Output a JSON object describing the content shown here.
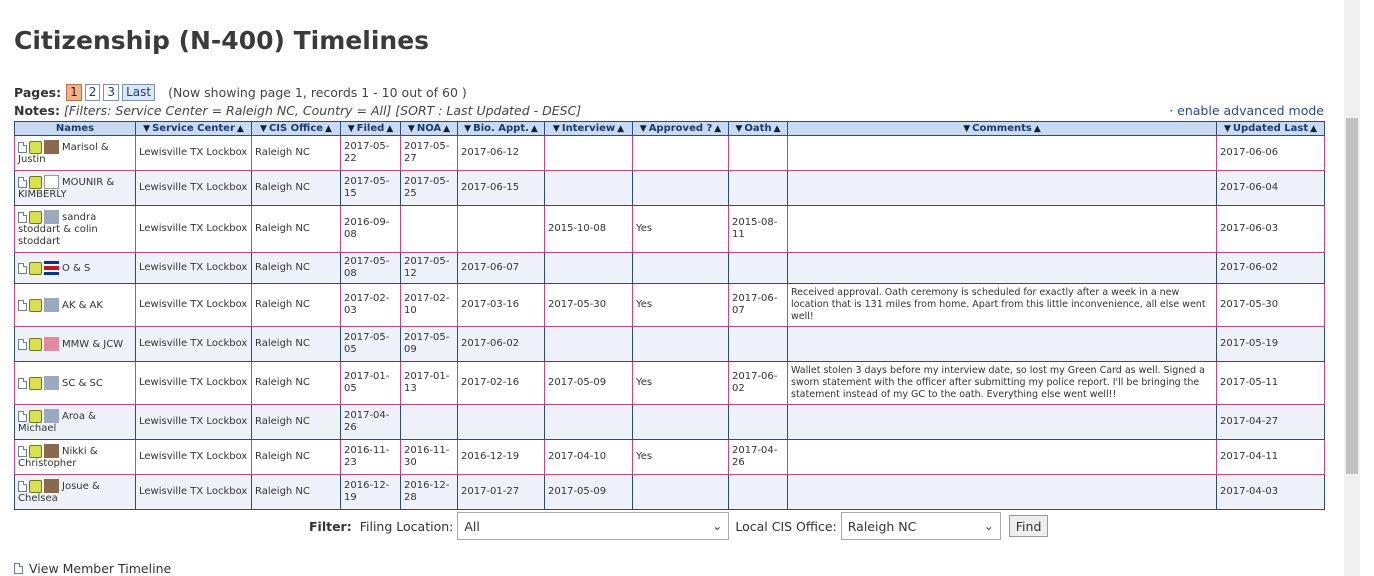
{
  "title": "Citizenship (N-400) Timelines",
  "pages": {
    "label": "Pages:",
    "items": [
      "1",
      "2",
      "3",
      "Last"
    ],
    "active": "1",
    "showing": "(Now showing page 1, records 1 - 10 out of 60 )"
  },
  "notes": {
    "label": "Notes:",
    "value": "[Filters: Service Center = Raleigh NC, Country = All] [SORT : Last Updated - DESC]",
    "advanced": "· enable advanced mode"
  },
  "columns": [
    "Names",
    "Service Center",
    "CIS Office",
    "Filed",
    "NOA",
    "Bio. Appt.",
    "Interview",
    "Approved ?",
    "Oath",
    "Comments",
    "Updated Last"
  ],
  "rows": [
    {
      "name": "Marisol & Justin",
      "center": "Lewisville TX Lockbox",
      "office": "Raleigh NC",
      "filed": "2017-05-22",
      "noa": "2017-05-27",
      "bio": "2017-06-12",
      "interview": "",
      "approved": "",
      "oath": "",
      "comments": "",
      "updated": "2017-06-06",
      "avatar": "photo-avatar"
    },
    {
      "name": "MOUNIR & KIMBERLY",
      "center": "Lewisville TX Lockbox",
      "office": "Raleigh NC",
      "filed": "2017-05-15",
      "noa": "2017-05-25",
      "bio": "2017-06-15",
      "interview": "",
      "approved": "",
      "oath": "",
      "comments": "",
      "updated": "2017-06-04",
      "avatar": "figure-avatar"
    },
    {
      "name": "sandra stoddart & colin stoddart",
      "center": "Lewisville TX Lockbox",
      "office": "Raleigh NC",
      "filed": "2016-09-08",
      "noa": "",
      "bio": "",
      "interview": "2015-10-08",
      "approved": "Yes",
      "oath": "2015-08-11",
      "comments": "",
      "updated": "2017-06-03",
      "avatar": "default-avatar"
    },
    {
      "name": "O & S",
      "center": "Lewisville TX Lockbox",
      "office": "Raleigh NC",
      "filed": "2017-05-08",
      "noa": "2017-05-12",
      "bio": "2017-06-07",
      "interview": "",
      "approved": "",
      "oath": "",
      "comments": "",
      "updated": "2017-06-02",
      "avatar": "flag-avatar"
    },
    {
      "name": "AK & AK",
      "center": "Lewisville TX Lockbox",
      "office": "Raleigh NC",
      "filed": "2017-02-03",
      "noa": "2017-02-10",
      "bio": "2017-03-16",
      "interview": "2017-05-30",
      "approved": "Yes",
      "oath": "2017-06-07",
      "comments": "Received approval. Oath ceremony is scheduled for exactly after a week in a new location that is 131 miles from home. Apart from this little inconvenience, all else went well!",
      "updated": "2017-05-30",
      "avatar": "default-avatar"
    },
    {
      "name": "MMW & JCW",
      "center": "Lewisville TX Lockbox",
      "office": "Raleigh NC",
      "filed": "2017-05-05",
      "noa": "2017-05-09",
      "bio": "2017-06-02",
      "interview": "",
      "approved": "",
      "oath": "",
      "comments": "",
      "updated": "2017-05-19",
      "avatar": "flower-avatar"
    },
    {
      "name": "SC & SC",
      "center": "Lewisville TX Lockbox",
      "office": "Raleigh NC",
      "filed": "2017-01-05",
      "noa": "2017-01-13",
      "bio": "2017-02-16",
      "interview": "2017-05-09",
      "approved": "Yes",
      "oath": "2017-06-02",
      "comments": "Wallet stolen 3 days before my interview date, so lost my Green Card as well. Signed a sworn statement with the officer after submitting my police report. I'll be bringing the statement instead of my GC to the oath. Everything else went well!!",
      "updated": "2017-05-11",
      "avatar": "default-avatar"
    },
    {
      "name": "Aroa & Michael",
      "center": "Lewisville TX Lockbox",
      "office": "Raleigh NC",
      "filed": "2017-04-26",
      "noa": "",
      "bio": "",
      "interview": "",
      "approved": "",
      "oath": "",
      "comments": "",
      "updated": "2017-04-27",
      "avatar": "default-avatar"
    },
    {
      "name": "Nikki & Christopher",
      "center": "Lewisville TX Lockbox",
      "office": "Raleigh NC",
      "filed": "2016-11-23",
      "noa": "2016-11-30",
      "bio": "2016-12-19",
      "interview": "2017-04-10",
      "approved": "Yes",
      "oath": "2017-04-26",
      "comments": "",
      "updated": "2017-04-11",
      "avatar": "photo-avatar"
    },
    {
      "name": "Josue & Chelsea",
      "center": "Lewisville TX Lockbox",
      "office": "Raleigh NC",
      "filed": "2016-12-19",
      "noa": "2016-12-28",
      "bio": "2017-01-27",
      "interview": "2017-05-09",
      "approved": "",
      "oath": "",
      "comments": "",
      "updated": "2017-04-03",
      "avatar": "photo-avatar"
    }
  ],
  "filter": {
    "label": "Filter:",
    "location_label": "Filing Location:",
    "location_value": "All",
    "office_label": "Local CIS Office:",
    "office_value": "Raleigh NC",
    "find": "Find"
  },
  "view_member": "View Member Timeline"
}
